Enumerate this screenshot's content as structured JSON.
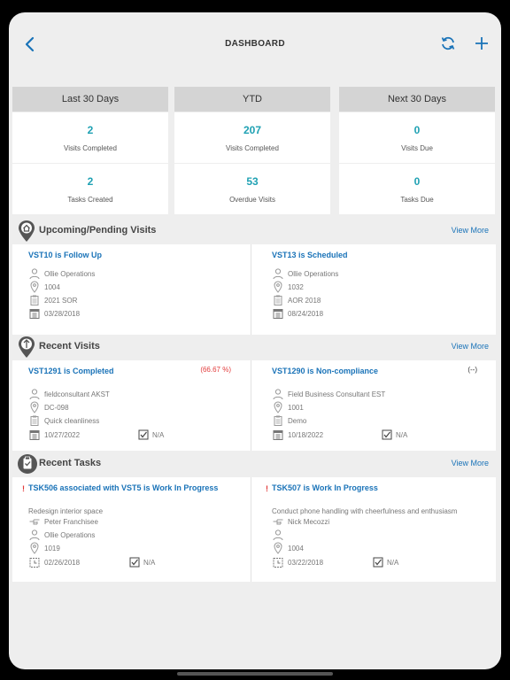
{
  "header": {
    "title": "DASHBOARD"
  },
  "stats": [
    {
      "period": "Last 30 Days",
      "cells": [
        {
          "value": "2",
          "label": "Visits Completed"
        },
        {
          "value": "2",
          "label": "Tasks Created"
        }
      ]
    },
    {
      "period": "YTD",
      "cells": [
        {
          "value": "207",
          "label": "Visits Completed"
        },
        {
          "value": "53",
          "label": "Overdue Visits"
        }
      ]
    },
    {
      "period": "Next 30 Days",
      "cells": [
        {
          "value": "0",
          "label": "Visits Due"
        },
        {
          "value": "0",
          "label": "Tasks Due"
        }
      ]
    }
  ],
  "upcoming": {
    "title": "Upcoming/Pending Visits",
    "view_more": "View More",
    "cards": [
      {
        "title": "VST10 is Follow Up",
        "user": "Ollie Operations",
        "location": "1004",
        "form": "2021 SOR",
        "date": "03/28/2018"
      },
      {
        "title": "VST13 is Scheduled",
        "user": "Ollie Operations",
        "location": "1032",
        "form": "AOR 2018",
        "date": "08/24/2018"
      }
    ]
  },
  "recent_visits": {
    "title": "Recent Visits",
    "view_more": "View More",
    "cards": [
      {
        "title": "VST1291 is Completed",
        "score": "(66.67 %)",
        "user": "fieldconsultant AKST",
        "location": "DC-098",
        "form": "Quick cleanliness",
        "date": "10/27/2022",
        "check": "N/A"
      },
      {
        "title": "VST1290 is Non-compliance",
        "score": "(--)",
        "user": "Field Business Consultant EST",
        "location": "1001",
        "form": "Demo",
        "date": "10/18/2022",
        "check": "N/A"
      }
    ]
  },
  "recent_tasks": {
    "title": "Recent Tasks",
    "view_more": "View More",
    "cards": [
      {
        "flag": "!",
        "title": "TSK506 associated with VST5 is Work In Progress",
        "description": "Redesign interior space",
        "assigned": "Peter Franchisee",
        "user": "Ollie Operations",
        "location": "1019",
        "date": "02/26/2018",
        "check": "N/A"
      },
      {
        "flag": "!",
        "title": "TSK507 is Work In Progress",
        "description": "Conduct phone handling with cheerfulness and enthusiasm",
        "assigned": "Nick Mecozzi",
        "user": "",
        "location": "1004",
        "date": "03/22/2018",
        "check": "N/A"
      }
    ]
  },
  "colors": {
    "accent": "#1a73b8",
    "teal": "#1fa1b3",
    "alert": "#e23b3b"
  }
}
